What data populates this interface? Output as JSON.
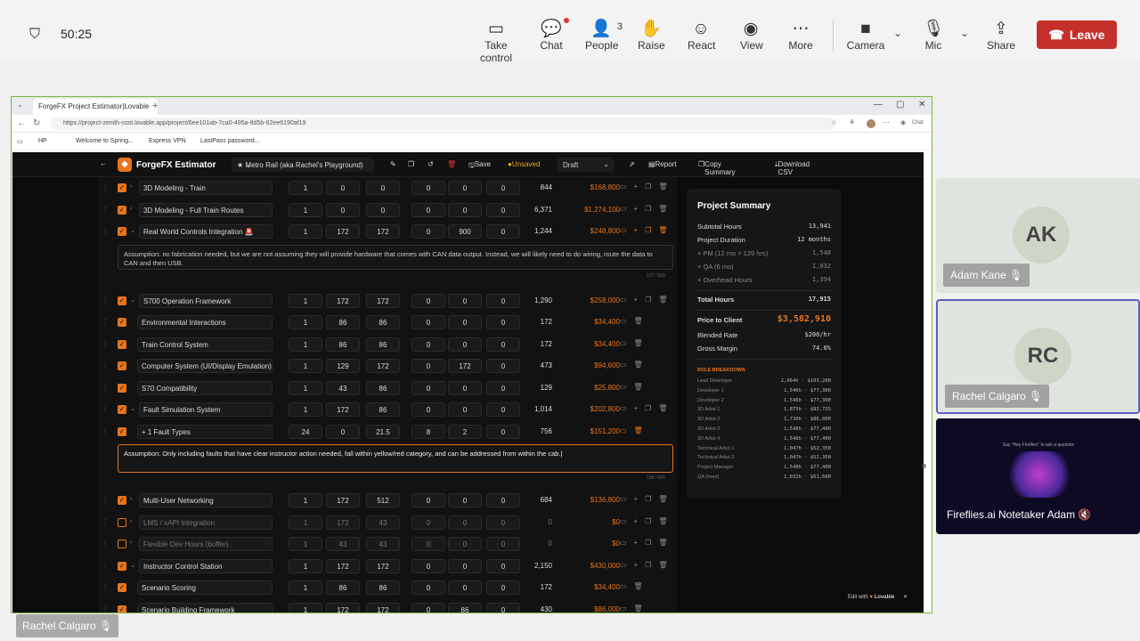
{
  "meeting": {
    "timer": "50:25",
    "toolbar": [
      {
        "label": "Take control",
        "icon": "take-control-icon",
        "glyph": "▭"
      },
      {
        "label": "Chat",
        "icon": "chat-icon",
        "glyph": "💬"
      },
      {
        "label": "People",
        "icon": "people-icon",
        "glyph": "👤",
        "badge": "3"
      },
      {
        "label": "Raise",
        "icon": "raise-hand-icon",
        "glyph": "✋"
      },
      {
        "label": "React",
        "icon": "react-icon",
        "glyph": "☺"
      },
      {
        "label": "View",
        "icon": "view-icon",
        "glyph": "◉"
      },
      {
        "label": "More",
        "icon": "more-icon",
        "glyph": "⋯"
      },
      {
        "label": "Camera",
        "icon": "camera-icon",
        "glyph": "■"
      },
      {
        "label": "Mic",
        "icon": "mic-muted-icon",
        "glyph": "🎙"
      },
      {
        "label": "Share",
        "icon": "share-icon",
        "glyph": "⇪"
      }
    ],
    "leave_label": "Leave",
    "participants": [
      {
        "initials": "AK",
        "name": "Adam Kane"
      },
      {
        "initials": "RC",
        "name": "Rachel Calgaro"
      },
      {
        "initials": "",
        "name": "Fireflies.ai Notetaker Adam",
        "caption": "Say \"Hey Fireflies\" to ask a question"
      }
    ],
    "presenter_name": "Rachel Calgaro",
    "leave_color": "#c4302b"
  },
  "browser": {
    "tab_title": "ForgeFX Project Estimator|Lovable",
    "url": "https://project-zenith-cost.lovable.app/project/6ee101ab-7ca0-495a-8d5b-62ee6190af19",
    "chat_label": "Chat",
    "bookmarks": [
      "HP",
      "Welcome to Spring...",
      "Express VPN",
      "LastPass password..."
    ]
  },
  "app": {
    "brand": "ForgeFX Estimator",
    "project": "Metro Rail (aka Rachel's Playground)",
    "save_label": "Save",
    "unsaved_label": "Unsaved",
    "status": "Draft",
    "report_label": "Report",
    "copy_summary_label": "Copy Summary",
    "download_label": "Download CSV",
    "accent": "#e8751a",
    "edit_with": "Edit with",
    "lovable": "Lovable"
  },
  "rows": [
    {
      "name": "3D Modeling - Train",
      "checked": true,
      "parent": true,
      "vals": [
        "1",
        "0",
        "0",
        "0",
        "0",
        "0"
      ],
      "hours": "844",
      "price": "$168,800"
    },
    {
      "name": "3D Modeling - Full Train Routes",
      "checked": true,
      "parent": true,
      "vals": [
        "1",
        "0",
        "0",
        "0",
        "0",
        "0"
      ],
      "hours": "6,371",
      "price": "$1,274,100"
    },
    {
      "name": "Real World Controls Integration 🚨",
      "checked": true,
      "parent": true,
      "expanded": true,
      "vals": [
        "1",
        "172",
        "172",
        "0",
        "900",
        "0"
      ],
      "hours": "1,244",
      "price": "$248,800",
      "note": "Assumption: no fabrication needed, but we are not assuming they will provide hardware that comes with CAN data output. Instead, we will likely need to do wiring, route the data to CAN and then USB.",
      "note_count": "177 / 500"
    },
    {
      "name": "S700 Operation Framework",
      "checked": true,
      "parent": true,
      "expanded": true,
      "vals": [
        "1",
        "172",
        "172",
        "0",
        "0",
        "0"
      ],
      "hours": "1,290",
      "price": "$258,000"
    },
    {
      "name": "Environmental Interactions",
      "checked": true,
      "child": true,
      "vals": [
        "1",
        "86",
        "86",
        "0",
        "0",
        "0"
      ],
      "hours": "172",
      "price": "$34,400"
    },
    {
      "name": "Train Control System",
      "checked": true,
      "child": true,
      "vals": [
        "1",
        "86",
        "86",
        "0",
        "0",
        "0"
      ],
      "hours": "172",
      "price": "$34,400"
    },
    {
      "name": "Computer System (UI/Display Emulation)",
      "checked": true,
      "child": true,
      "vals": [
        "1",
        "129",
        "172",
        "0",
        "172",
        "0"
      ],
      "hours": "473",
      "price": "$94,600"
    },
    {
      "name": "S70 Compatibility",
      "checked": true,
      "child": true,
      "vals": [
        "1",
        "43",
        "86",
        "0",
        "0",
        "0"
      ],
      "hours": "129",
      "price": "$25,800"
    },
    {
      "name": "Fault Simulation System",
      "checked": true,
      "parent": true,
      "expanded": true,
      "vals": [
        "1",
        "172",
        "86",
        "0",
        "0",
        "0"
      ],
      "hours": "1,014",
      "price": "$202,800"
    },
    {
      "name": "+ 1 Fault Types",
      "checked": true,
      "child": true,
      "vals": [
        "24",
        "0",
        "21.5",
        "8",
        "2",
        "0"
      ],
      "hours": "756",
      "price": "$151,200",
      "note": "Assumption: Only including faults that have clear instructor action needed, fall within yellow/red category, and can be addressed from within the cab.|",
      "note_count": "158 / 500",
      "note_active": true
    },
    {
      "name": "Multi-User Networking",
      "checked": true,
      "parent": true,
      "vals": [
        "1",
        "172",
        "512",
        "0",
        "0",
        "0"
      ],
      "hours": "684",
      "price": "$136,800"
    },
    {
      "name": "LMS / xAPI Integration",
      "checked": false,
      "parent": true,
      "vals": [
        "1",
        "172",
        "43",
        "0",
        "0",
        "0"
      ],
      "hours": "0",
      "price": "$0"
    },
    {
      "name": "Flexible Dev Hours (buffer)",
      "checked": false,
      "parent": true,
      "vals": [
        "1",
        "43",
        "43",
        "0",
        "0",
        "0"
      ],
      "hours": "0",
      "price": "$0"
    },
    {
      "name": "Instructor Control Station",
      "checked": true,
      "parent": true,
      "expanded": true,
      "vals": [
        "1",
        "172",
        "172",
        "0",
        "0",
        "0"
      ],
      "hours": "2,150",
      "price": "$430,000"
    },
    {
      "name": "Scenario Scoring",
      "checked": true,
      "child": true,
      "vals": [
        "1",
        "86",
        "86",
        "0",
        "0",
        "0"
      ],
      "hours": "172",
      "price": "$34,400"
    },
    {
      "name": "Scenario Building Framework",
      "checked": true,
      "child": true,
      "vals": [
        "1",
        "172",
        "172",
        "0",
        "86",
        "0"
      ],
      "hours": "430",
      "price": "$86,000"
    }
  ],
  "summary": {
    "title": "Project Summary",
    "lines": [
      {
        "label": "Subtotal Hours",
        "value": "13,941"
      },
      {
        "label": "Project Duration",
        "value": "12 months"
      },
      {
        "label": "+ PM (12 mo × 129 hrs)",
        "value": "1,548",
        "sub": true
      },
      {
        "label": "+ QA (6 mo)",
        "value": "1,032",
        "sub": true
      },
      {
        "label": "+ Overhead Hours",
        "value": "1,394",
        "sub": true
      }
    ],
    "total_label": "Total Hours",
    "total_value": "17,915",
    "price_label": "Price to Client",
    "price_value": "$3,582,910",
    "rate_label": "Blended Rate",
    "rate_value": "$200/hr",
    "margin_label": "Gross Margin",
    "margin_value": "74.6%",
    "breakdown_title": "ROLE BREAKDOWN",
    "roles": [
      {
        "role": "Lead Developer",
        "value": "2,064h · $103,200"
      },
      {
        "role": "Developer 1",
        "value": "1,546h · $77,300"
      },
      {
        "role": "Developer 2",
        "value": "1,546h · $77,300"
      },
      {
        "role": "3D Artist 1",
        "value": "1,875h · $93,725"
      },
      {
        "role": "3D Artist 2",
        "value": "1,720h · $86,000"
      },
      {
        "role": "3D Artist 3",
        "value": "1,548h · $77,400"
      },
      {
        "role": "3D Artist 4",
        "value": "1,548h · $77,400"
      },
      {
        "role": "Technical Artist 1",
        "value": "1,047h · $52,350"
      },
      {
        "role": "Technical Artist 2",
        "value": "1,047h · $52,350"
      },
      {
        "role": "Project Manager",
        "value": "1,548h · $77,400"
      },
      {
        "role": "QA (fixed)",
        "value": "1,032h · $51,600"
      }
    ]
  }
}
